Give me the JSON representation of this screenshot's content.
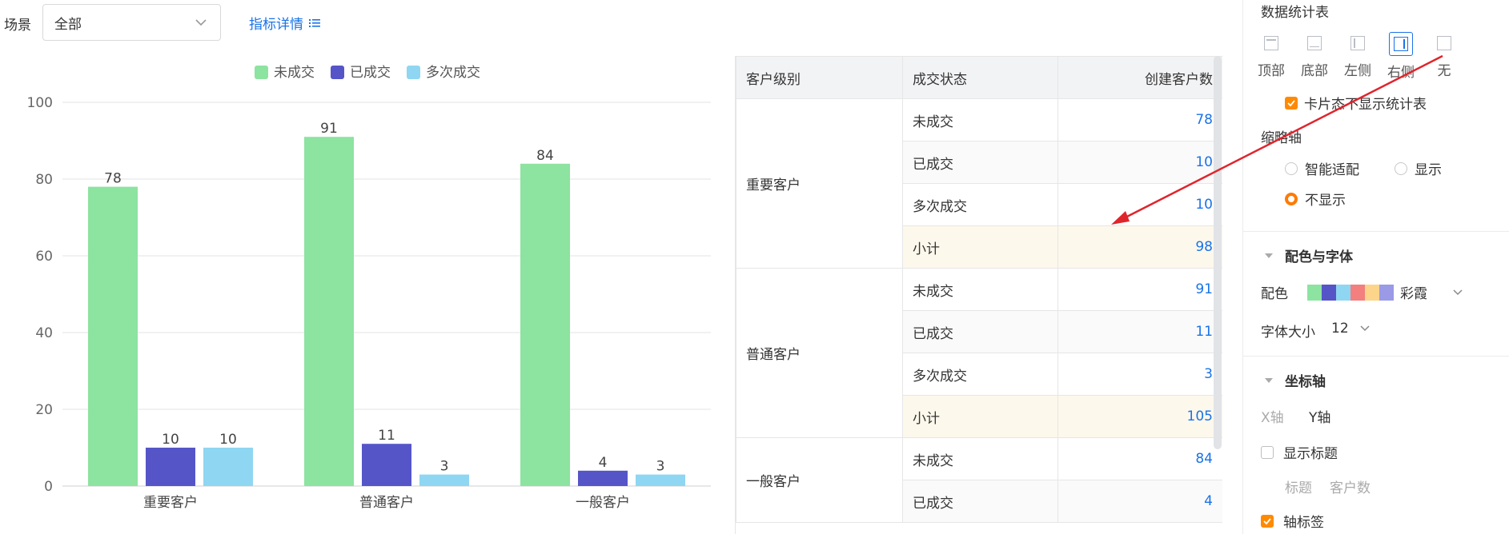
{
  "filter": {
    "scene_label": "场景",
    "scene_value": "全部",
    "detail_link": "指标详情"
  },
  "chart_data": {
    "type": "bar",
    "categories": [
      "重要客户",
      "普通客户",
      "一般客户"
    ],
    "series": [
      {
        "name": "未成交",
        "values": [
          78,
          91,
          84
        ],
        "color": "#8de3a0"
      },
      {
        "name": "已成交",
        "values": [
          10,
          11,
          4
        ],
        "color": "#5555c8"
      },
      {
        "name": "多次成交",
        "values": [
          10,
          3,
          3
        ],
        "color": "#8fd6f2"
      }
    ],
    "ylim": [
      0,
      100
    ],
    "yticks": [
      0,
      20,
      40,
      60,
      80,
      100
    ],
    "legend": "top-center",
    "grid": true
  },
  "table": {
    "headers": [
      "客户级别",
      "成交状态",
      "创建客户数"
    ],
    "groups": [
      {
        "level": "重要客户",
        "rows": [
          {
            "status": "未成交",
            "count": "78"
          },
          {
            "status": "已成交",
            "count": "10"
          },
          {
            "status": "多次成交",
            "count": "10"
          },
          {
            "status": "小计",
            "count": "98",
            "subtotal": true
          }
        ]
      },
      {
        "level": "普通客户",
        "rows": [
          {
            "status": "未成交",
            "count": "91"
          },
          {
            "status": "已成交",
            "count": "11"
          },
          {
            "status": "多次成交",
            "count": "3"
          },
          {
            "status": "小计",
            "count": "105",
            "subtotal": true
          }
        ]
      },
      {
        "level": "一般客户",
        "rows": [
          {
            "status": "未成交",
            "count": "84"
          },
          {
            "status": "已成交",
            "count": "4"
          }
        ]
      }
    ]
  },
  "panel": {
    "stats_title": "数据统计表",
    "positions": [
      "顶部",
      "底部",
      "左侧",
      "右侧",
      "无"
    ],
    "selected_position": "右侧",
    "card_hide_label": "卡片态不显示统计表",
    "thumb_axis_title": "缩略轴",
    "thumb_options": [
      "智能适配",
      "显示",
      "不显示"
    ],
    "thumb_selected": "不显示",
    "color_font_title": "配色与字体",
    "palette_label": "配色",
    "palette_name": "彩霞",
    "palette_colors": [
      "#8de3a0",
      "#5555c8",
      "#8fd6f2",
      "#f37f7f",
      "#fcd58a",
      "#9a9ae6"
    ],
    "font_size_label": "字体大小",
    "font_size_value": "12",
    "axis_title": "坐标轴",
    "x_axis_tab": "X轴",
    "y_axis_tab": "Y轴",
    "show_title_label": "显示标题",
    "title_label": "标题",
    "title_placeholder": "客户数",
    "axis_tick_label": "轴标签"
  },
  "colors": {
    "accent": "#1a73e8",
    "orange": "#ff8a00",
    "annotation_arrow": "#e0242c"
  }
}
